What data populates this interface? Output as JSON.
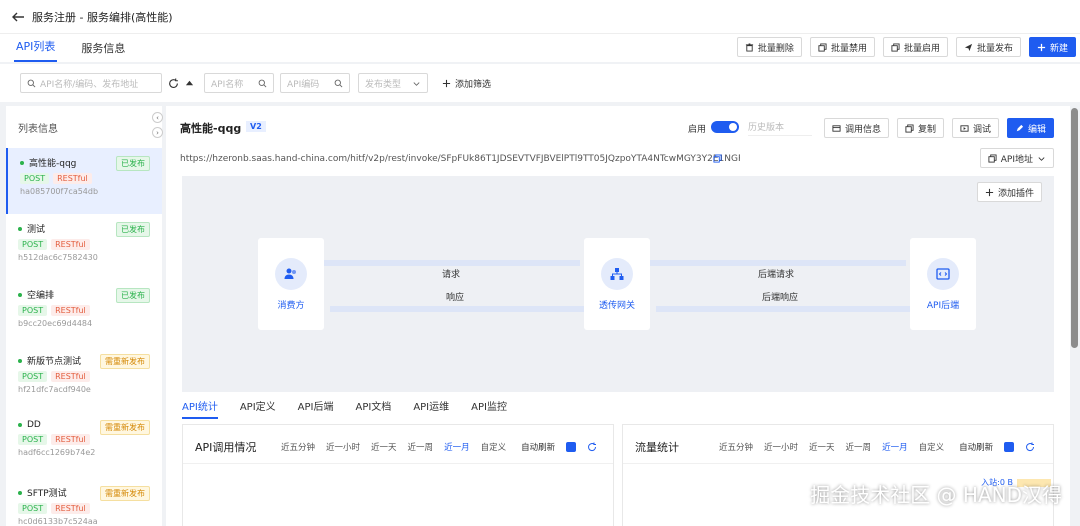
{
  "header": {
    "title": "服务注册 - 服务编排(高性能)"
  },
  "tabs": [
    {
      "label": "API列表"
    },
    {
      "label": "服务信息"
    }
  ],
  "toolbar": {
    "batch_delete": "批量删除",
    "batch_disable": "批量禁用",
    "batch_enable": "批量启用",
    "batch_publish": "批量发布",
    "create": "新建"
  },
  "filters": {
    "search_placeholder": "API名称/编码、发布地址",
    "api_name": "API名称",
    "api_code": "API编码",
    "publish_type": "发布类型",
    "add_filter": "添加筛选"
  },
  "list": {
    "title": "列表信息",
    "items": [
      {
        "name": "高性能-qqg",
        "status": "已发布",
        "method": "POST",
        "type": "RESTful",
        "id": "ha085700f7ca54db"
      },
      {
        "name": "测试",
        "status": "已发布",
        "method": "POST",
        "type": "RESTful",
        "id": "h512dac6c7582430"
      },
      {
        "name": "空编排",
        "status": "已发布",
        "method": "POST",
        "type": "RESTful",
        "id": "b9cc20ec69d4484"
      },
      {
        "name": "新版节点测试",
        "status": "需重新发布",
        "method": "POST",
        "type": "RESTful",
        "id": "hf21dfc7acdf940e"
      },
      {
        "name": "DD",
        "status": "需重新发布",
        "method": "POST",
        "type": "RESTful",
        "id": "hadf6cc1269b74e2"
      },
      {
        "name": "SFTP测试",
        "status": "需重新发布",
        "method": "POST",
        "type": "RESTful",
        "id": "hc0d6133b7c524aa"
      }
    ]
  },
  "detail": {
    "name": "高性能-qqg",
    "version": "V2",
    "enable_label": "启用",
    "history_version": "历史版本",
    "btn_invoke_info": "调用信息",
    "btn_copy": "复制",
    "btn_debug": "调试",
    "btn_edit": "编辑",
    "url": "https://hzeronb.saas.hand-china.com/hitf/v2p/rest/invoke/SFpFUk86T1JDSEVTVFJBVElPTl9TT05JQzpoYTA4NTcwMGY3Y2E1NGRi",
    "api_address": "API地址",
    "add_plugin": "添加插件"
  },
  "diagram": {
    "consumer": "消费方",
    "gateway": "透传网关",
    "backend": "API后端",
    "request": "请求",
    "response": "响应",
    "backend_request": "后端请求",
    "backend_response": "后端响应"
  },
  "subtabs": [
    "API统计",
    "API定义",
    "API后端",
    "API文档",
    "API运维",
    "API监控"
  ],
  "stats": {
    "call_title": "API调用情况",
    "traffic_title": "流量统计",
    "ranges": [
      "近五分钟",
      "近一小时",
      "近一天",
      "近一周",
      "近一月",
      "自定义"
    ],
    "auto_refresh": "自动刷新",
    "inbound": "入站:0 B"
  },
  "watermark": "掘金技术社区 @ HAND汉得",
  "colors": {
    "primary": "#1f5cf0",
    "published": "#2bb24c",
    "republish": "#d48806"
  }
}
